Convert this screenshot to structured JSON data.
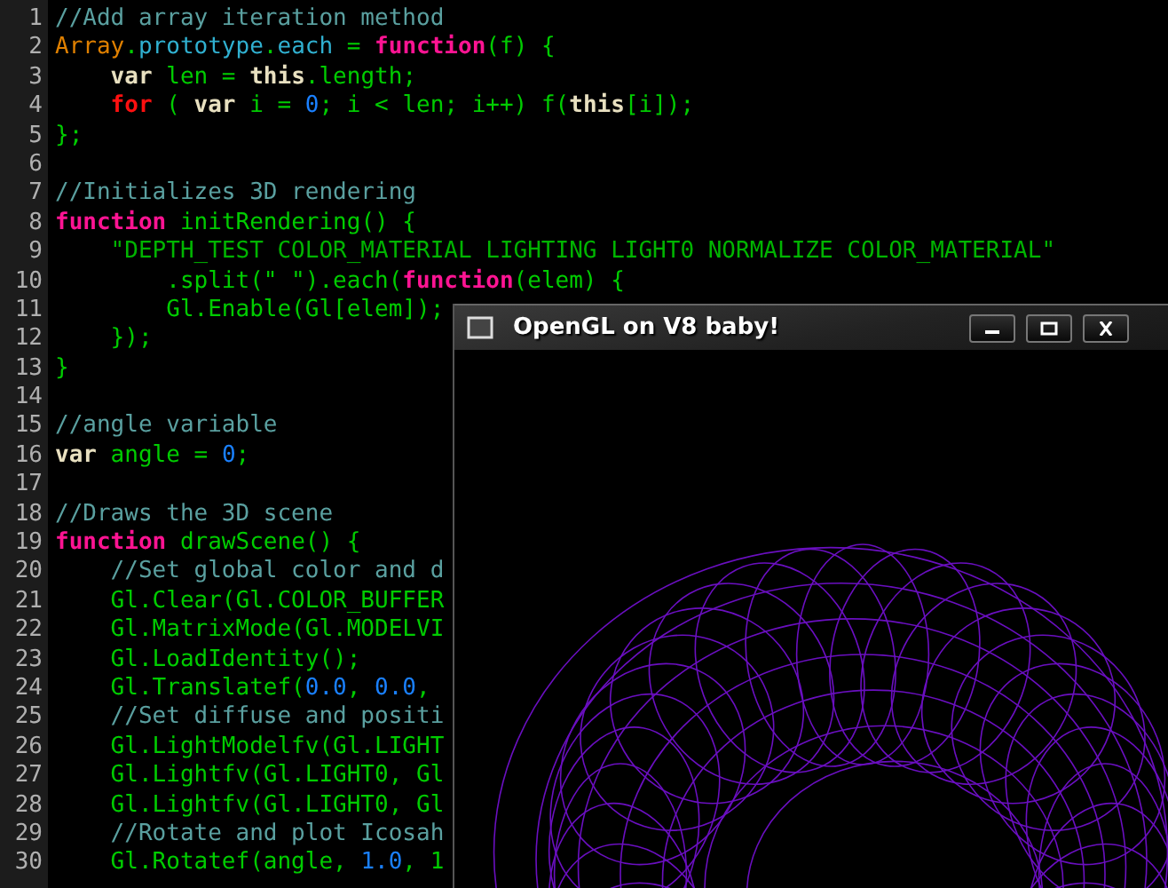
{
  "editor": {
    "lines": [
      {
        "number": "1",
        "tokens": [
          {
            "kind": "comment",
            "text": "//Add array iteration method"
          }
        ]
      },
      {
        "number": "2",
        "tokens": [
          {
            "kind": "builtin",
            "text": "Array"
          },
          {
            "kind": "plain",
            "text": "."
          },
          {
            "kind": "property",
            "text": "prototype"
          },
          {
            "kind": "plain",
            "text": "."
          },
          {
            "kind": "property",
            "text": "each"
          },
          {
            "kind": "plain",
            "text": " = "
          },
          {
            "kind": "function",
            "text": "function"
          },
          {
            "kind": "plain",
            "text": "(f) {"
          }
        ]
      },
      {
        "number": "3",
        "tokens": [
          {
            "kind": "keyword",
            "text": "    var"
          },
          {
            "kind": "plain",
            "text": " len = "
          },
          {
            "kind": "keyword",
            "text": "this"
          },
          {
            "kind": "plain",
            "text": ".length;"
          }
        ]
      },
      {
        "number": "4",
        "tokens": [
          {
            "kind": "control",
            "text": "    for"
          },
          {
            "kind": "plain",
            "text": " ( "
          },
          {
            "kind": "keyword",
            "text": "var"
          },
          {
            "kind": "plain",
            "text": " i = "
          },
          {
            "kind": "number",
            "text": "0"
          },
          {
            "kind": "plain",
            "text": "; i < len; i++) f("
          },
          {
            "kind": "keyword",
            "text": "this"
          },
          {
            "kind": "plain",
            "text": "[i]);"
          }
        ]
      },
      {
        "number": "5",
        "tokens": [
          {
            "kind": "plain",
            "text": "};"
          }
        ]
      },
      {
        "number": "6"
      },
      {
        "number": "7",
        "tokens": [
          {
            "kind": "comment",
            "text": "//Initializes 3D rendering"
          }
        ]
      },
      {
        "number": "8",
        "tokens": [
          {
            "kind": "function",
            "text": "function"
          },
          {
            "kind": "plain",
            "text": " initRendering() {"
          }
        ]
      },
      {
        "number": "9",
        "tokens": [
          {
            "kind": "string",
            "text": "    \"DEPTH_TEST COLOR_MATERIAL LIGHTING LIGHT0 NORMALIZE COLOR_MATERIAL\""
          }
        ]
      },
      {
        "number": "10",
        "tokens": [
          {
            "kind": "plain",
            "text": "        .split(\" \").each("
          },
          {
            "kind": "function",
            "text": "function"
          },
          {
            "kind": "plain",
            "text": "(elem) {"
          }
        ]
      },
      {
        "number": "11",
        "tokens": [
          {
            "kind": "plain",
            "text": "        Gl.Enable(Gl[elem]);"
          }
        ]
      },
      {
        "number": "12",
        "tokens": [
          {
            "kind": "plain",
            "text": "    });"
          }
        ]
      },
      {
        "number": "13",
        "tokens": [
          {
            "kind": "plain",
            "text": "}"
          }
        ]
      },
      {
        "number": "14"
      },
      {
        "number": "15",
        "tokens": [
          {
            "kind": "comment",
            "text": "//angle variable"
          }
        ]
      },
      {
        "number": "16",
        "tokens": [
          {
            "kind": "keyword",
            "text": "var"
          },
          {
            "kind": "plain",
            "text": " angle = "
          },
          {
            "kind": "number",
            "text": "0"
          },
          {
            "kind": "plain",
            "text": ";"
          }
        ]
      },
      {
        "number": "17"
      },
      {
        "number": "18",
        "tokens": [
          {
            "kind": "comment",
            "text": "//Draws the 3D scene"
          }
        ]
      },
      {
        "number": "19",
        "tokens": [
          {
            "kind": "function",
            "text": "function"
          },
          {
            "kind": "plain",
            "text": " drawScene() {"
          }
        ]
      },
      {
        "number": "20",
        "tokens": [
          {
            "kind": "comment",
            "text": "    //Set global color and d"
          }
        ]
      },
      {
        "number": "21",
        "tokens": [
          {
            "kind": "plain",
            "text": "    Gl.Clear(Gl.COLOR_BUFFER"
          }
        ]
      },
      {
        "number": "22",
        "tokens": [
          {
            "kind": "plain",
            "text": "    Gl.MatrixMode(Gl.MODELVI"
          }
        ]
      },
      {
        "number": "23",
        "tokens": [
          {
            "kind": "plain",
            "text": "    Gl.LoadIdentity();"
          }
        ]
      },
      {
        "number": "24",
        "tokens": [
          {
            "kind": "plain",
            "text": "    Gl.Translatef("
          },
          {
            "kind": "number",
            "text": "0.0"
          },
          {
            "kind": "plain",
            "text": ", "
          },
          {
            "kind": "number",
            "text": "0.0"
          },
          {
            "kind": "plain",
            "text": ","
          }
        ]
      },
      {
        "number": "25",
        "tokens": [
          {
            "kind": "comment",
            "text": "    //Set diffuse and positi"
          }
        ]
      },
      {
        "number": "26",
        "tokens": [
          {
            "kind": "plain",
            "text": "    Gl.LightModelfv(Gl.LIGHT"
          }
        ]
      },
      {
        "number": "27",
        "tokens": [
          {
            "kind": "plain",
            "text": "    Gl.Lightfv(Gl.LIGHT0, Gl"
          }
        ]
      },
      {
        "number": "28",
        "tokens": [
          {
            "kind": "plain",
            "text": "    Gl.Lightfv(Gl.LIGHT0, Gl"
          }
        ]
      },
      {
        "number": "29",
        "tokens": [
          {
            "kind": "comment",
            "text": "    //Rotate and plot Icosah"
          }
        ]
      },
      {
        "number": "30",
        "tokens": [
          {
            "kind": "plain",
            "text": "    Gl.Rotatef(angle, "
          },
          {
            "kind": "number",
            "text": "1.0"
          },
          {
            "kind": "plain",
            "text": ", 1"
          }
        ]
      }
    ]
  },
  "window": {
    "title": "OpenGL on V8 baby!"
  }
}
